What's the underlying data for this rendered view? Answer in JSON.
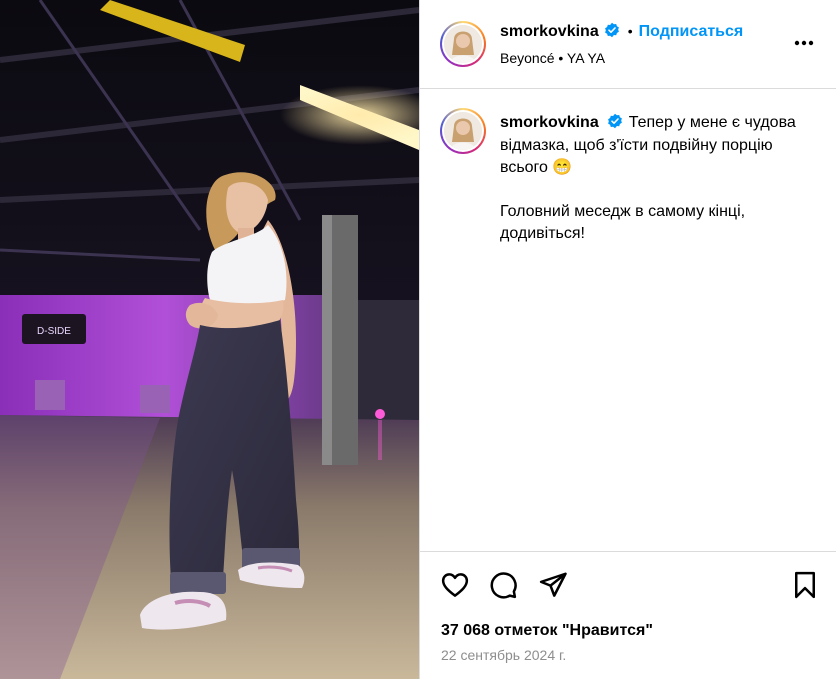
{
  "post": {
    "username": "smorkovkina",
    "follow_label": "Подписаться",
    "separator": "•",
    "music": "Beyoncé • YA YA",
    "caption_line1": "Тепер у мене є чудова відмазка, щоб з'їсти подвійну порцію всього 😁",
    "caption_line2": "Головний меседж в самому кінці, додивіться!",
    "likes": "37 068 отметок \"Нравится\"",
    "date": "22 сентябрь 2024 г."
  },
  "studio_sign": "D-SIDE",
  "colors": {
    "accent": "#0095f6",
    "verified": "#0095f6",
    "muted": "#8e8e8e",
    "border": "#dbdbdb"
  },
  "icons": [
    "verified-badge-icon",
    "more-options-icon",
    "heart-icon",
    "comment-icon",
    "share-icon",
    "bookmark-icon"
  ]
}
